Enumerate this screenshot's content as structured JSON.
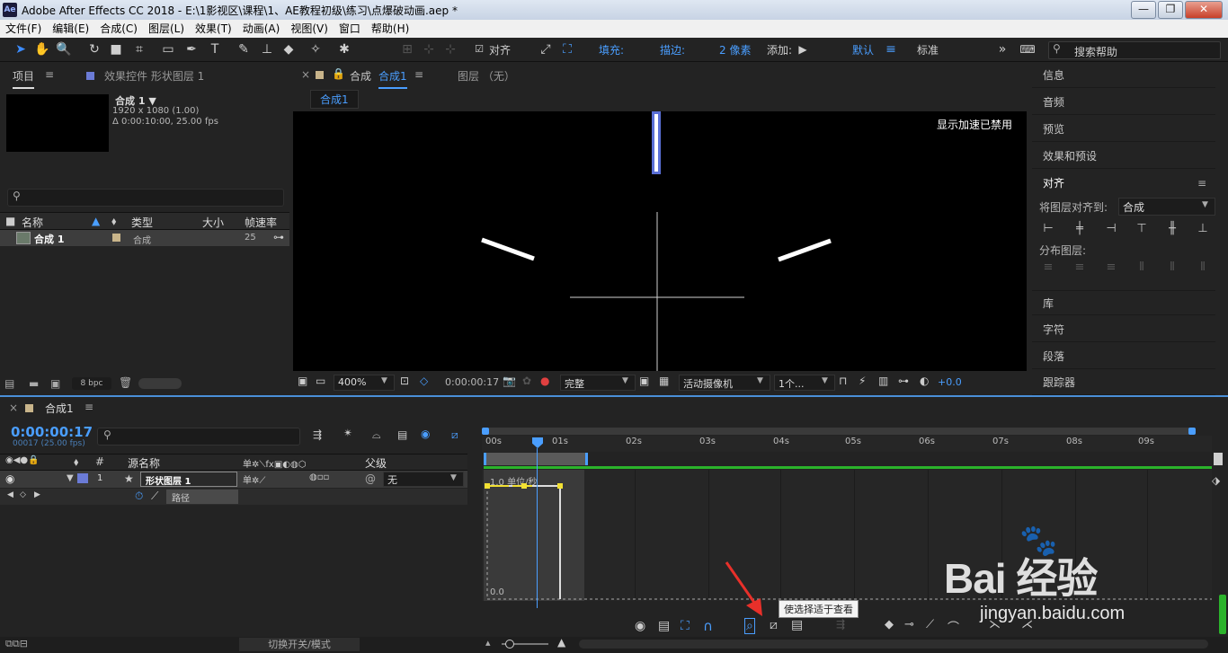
{
  "window": {
    "app_icon": "Ae",
    "title": "Adobe After Effects CC 2018 - E:\\1影视区\\课程\\1、AE教程初级\\练习\\点爆破动画.aep *",
    "minimize": "—",
    "maximize": "❐",
    "close": "✕"
  },
  "menu": [
    "文件(F)",
    "编辑(E)",
    "合成(C)",
    "图层(L)",
    "效果(T)",
    "动画(A)",
    "视图(V)",
    "窗口",
    "帮助(H)"
  ],
  "toolbar": {
    "align_label": "对齐",
    "fill_label": "填充:",
    "fill_value": "?",
    "stroke_label": "描边:",
    "stroke_width": "2 像素",
    "add_label": "添加:",
    "workspace_default": "默认",
    "workspace_standard": "标准",
    "search_placeholder": "搜索帮助"
  },
  "project_panel": {
    "tab_project": "项目",
    "tab_effects": "效果控件 形状图层 1",
    "comp_name": "合成 1 ▼",
    "comp_res": "1920 x 1080 (1.00)",
    "comp_duration": "Δ 0:00:10:00, 25.00 fps",
    "search_placeholder": "",
    "columns": {
      "name": "名称",
      "type": "类型",
      "size": "大小",
      "fps": "帧速率"
    },
    "row": {
      "name": "合成 1",
      "type": "合成",
      "fps": "25"
    },
    "bpc": "8 bpc"
  },
  "comp_panel": {
    "tab_label": "合成",
    "tab_name": "合成1",
    "layer_tab": "图层 （无）",
    "breadcrumb": "合成1",
    "gpu_notice": "显示加速已禁用",
    "zoom": "400%",
    "timecode": "0:00:00:17",
    "quality": "完整",
    "camera": "活动摄像机",
    "views": "1个...",
    "exposure": "+0.0"
  },
  "right_panels": {
    "info": "信息",
    "audio": "音频",
    "preview": "预览",
    "effects_presets": "效果和预设",
    "align": "对齐",
    "align_to_label": "将图层对齐到:",
    "align_to_value": "合成",
    "distribute_label": "分布图层:",
    "library": "库",
    "character": "字符",
    "paragraph": "段落",
    "tracker": "跟踪器"
  },
  "timeline": {
    "tab_name": "合成1",
    "timecode": "0:00:00:17",
    "frame_info": "00017 (25.00 fps)",
    "columns": {
      "num": "#",
      "source": "源名称",
      "parent": "父级"
    },
    "layer": {
      "index": "1",
      "name": "形状图层 1",
      "parent": "无"
    },
    "property": "路径",
    "ruler": [
      "00s",
      "01s",
      "02s",
      "03s",
      "04s",
      "05s",
      "06s",
      "07s",
      "08s",
      "09s"
    ],
    "graph_top": "1.0 单位/秒",
    "graph_bottom": "0.0",
    "tooltip": "使选择适于查看",
    "footer_toggle": "切换开关/模式"
  },
  "watermark": {
    "brand": "Bai 经验",
    "url": "jingyan.baidu.com"
  },
  "colors": {
    "accent": "#4a9eff",
    "layer_label": "#6b7bd6",
    "work_area": "#2bb32b",
    "keyframe": "#f2e033",
    "red_arrow": "#e8302a"
  }
}
